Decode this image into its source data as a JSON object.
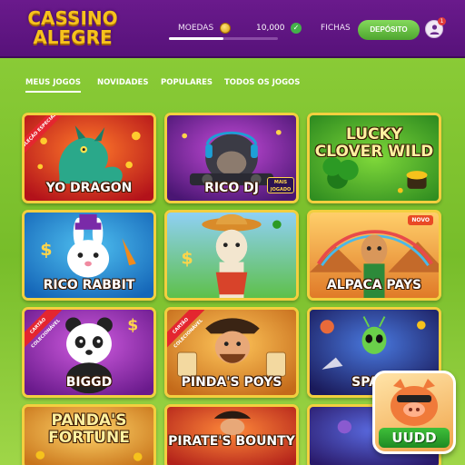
{
  "header": {
    "logo_line1": "CASSINO",
    "logo_line2": "ALEGRE",
    "balance_label": "MOEDAS",
    "balance_value": "10,000",
    "balance_progress": 0.5,
    "fichas_label": "FICHAS",
    "deposit_label": "DEPÓSITO",
    "notification_count": "1"
  },
  "tabs": [
    {
      "label": "MEUS JOGOS",
      "active": true
    },
    {
      "label": "NOVIDADES",
      "active": false
    },
    {
      "label": "POPULARES",
      "active": false
    },
    {
      "label": "TODOS OS JOGOS",
      "active": false
    }
  ],
  "games": [
    {
      "title": "YO DRAGON",
      "ribbon": "COLEÇÃO ESPECIAL"
    },
    {
      "title": "RICO DJ",
      "mini": "MAIS JOGADO"
    },
    {
      "title": "LUCKY CLOVER WILD"
    },
    {
      "title": "RICO RABBIT"
    },
    {
      "title": ""
    },
    {
      "title": "ALPACA PAYS",
      "badge": "NOVO"
    },
    {
      "title": "BIGGD",
      "ribbon": "CARTÃO COLECIONÁVEL"
    },
    {
      "title": "PINDA'S POYS",
      "ribbon": "CARTÃO COLECIONÁVEL"
    },
    {
      "title": "SPACE"
    },
    {
      "title": "PANDA'S FORTUNE"
    },
    {
      "title": "PIRATE'S BOUNTY"
    },
    {
      "title": ""
    }
  ],
  "floating_app": {
    "label": "UUDD"
  },
  "colors": {
    "header": "#5f1580",
    "background": "#86c834",
    "card_border": "#f3cf3f",
    "deposit": "#5cb83a",
    "logo": "#f6c21c"
  }
}
